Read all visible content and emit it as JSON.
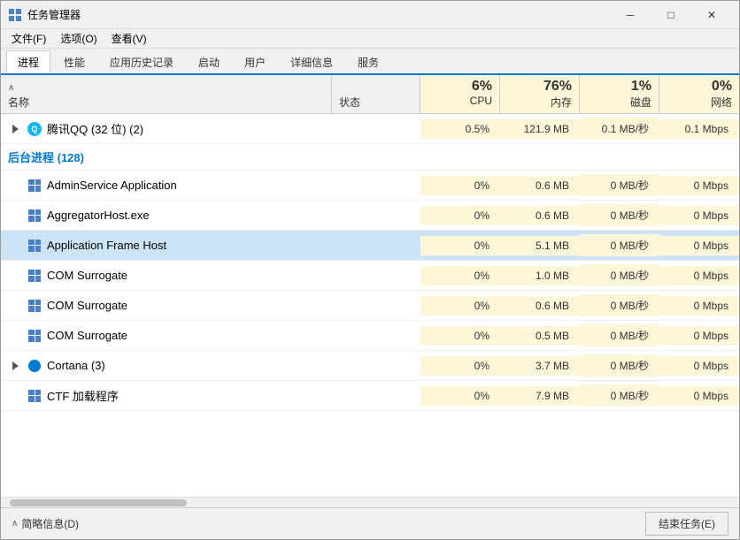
{
  "window": {
    "title": "任务管理器",
    "min_btn": "─",
    "max_btn": "□",
    "close_btn": "✕"
  },
  "menu": {
    "items": [
      "文件(F)",
      "选项(O)",
      "查看(V)"
    ]
  },
  "tabs": {
    "items": [
      "进程",
      "性能",
      "应用历史记录",
      "启动",
      "用户",
      "详细信息",
      "服务"
    ],
    "active": 0
  },
  "table": {
    "sort_arrow": "∧",
    "col_name": "名称",
    "col_status": "状态",
    "col_cpu": {
      "percent": "6%",
      "label": "CPU"
    },
    "col_mem": {
      "percent": "76%",
      "label": "内存"
    },
    "col_disk": {
      "percent": "1%",
      "label": "磁盘"
    },
    "col_net": {
      "percent": "0%",
      "label": "网络"
    }
  },
  "rows": {
    "app_group_label": "腾讯QQ (32 位) (2)",
    "qq_cpu": "0.5%",
    "qq_mem": "121.9 MB",
    "qq_disk": "0.1 MB/秒",
    "qq_net": "0.1 Mbps",
    "bg_section": "后台进程 (128)",
    "processes": [
      {
        "name": "AdminService Application",
        "status": "",
        "cpu": "0%",
        "mem": "0.6 MB",
        "disk": "0 MB/秒",
        "net": "0 Mbps",
        "icon": "app",
        "expandable": false
      },
      {
        "name": "AggregatorHost.exe",
        "status": "",
        "cpu": "0%",
        "mem": "0.6 MB",
        "disk": "0 MB/秒",
        "net": "0 Mbps",
        "icon": "app",
        "expandable": false
      },
      {
        "name": "Application Frame Host",
        "status": "",
        "cpu": "0%",
        "mem": "5.1 MB",
        "disk": "0 MB/秒",
        "net": "0 Mbps",
        "icon": "app",
        "expandable": false,
        "selected": true
      },
      {
        "name": "COM Surrogate",
        "status": "",
        "cpu": "0%",
        "mem": "1.0 MB",
        "disk": "0 MB/秒",
        "net": "0 Mbps",
        "icon": "app",
        "expandable": false
      },
      {
        "name": "COM Surrogate",
        "status": "",
        "cpu": "0%",
        "mem": "0.6 MB",
        "disk": "0 MB/秒",
        "net": "0 Mbps",
        "icon": "app",
        "expandable": false
      },
      {
        "name": "COM Surrogate",
        "status": "",
        "cpu": "0%",
        "mem": "0.5 MB",
        "disk": "0 MB/秒",
        "net": "0 Mbps",
        "icon": "app",
        "expandable": false
      },
      {
        "name": "Cortana (3)",
        "status": "",
        "cpu": "0%",
        "mem": "3.7 MB",
        "disk": "0 MB/秒",
        "net": "0 Mbps",
        "icon": "cortana",
        "expandable": true
      },
      {
        "name": "CTF 加载程序",
        "status": "",
        "cpu": "0%",
        "mem": "7.9 MB",
        "disk": "0 MB/秒",
        "net": "0 Mbps",
        "icon": "ctf",
        "expandable": false
      }
    ]
  },
  "bottom": {
    "summary_arrow": "∧",
    "summary_label": "简略信息(D)",
    "end_task": "结束任务(E)"
  }
}
